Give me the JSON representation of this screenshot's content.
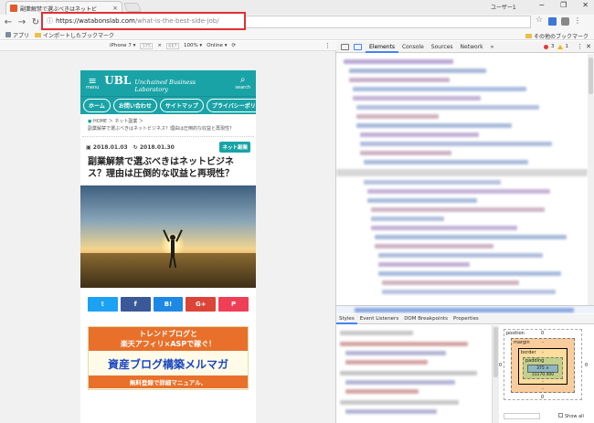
{
  "window": {
    "tab_title": "副業解禁で選ぶべきはネットビ",
    "user_label": "ユーザー1"
  },
  "toolbar": {
    "url_host": "https://watabonslab.com",
    "url_path": "/what-is-the-best-side-job/"
  },
  "bookmarks": {
    "apps_label": "アプリ",
    "imported_label": "インポートしたブックマーク",
    "other_label": "その他のブックマーク"
  },
  "device_bar": {
    "device": "iPhone 7",
    "width": "375",
    "height": "667",
    "zoom": "100%",
    "network": "Online"
  },
  "site": {
    "logo_main": "UBL",
    "logo_sub": "Unchained Business Laboratory",
    "menu_label": "menu",
    "search_label": "search",
    "nav": [
      "ホーム",
      "お問い合わせ",
      "サイトマップ",
      "プライバシーポリ"
    ],
    "crumb_home": "HOME",
    "crumb_category": "ネット副業",
    "crumb_current": "副業解禁で選ぶべきはネットビジネス？理由は圧倒的な収益と再現性？",
    "date_published": "2018.01.03",
    "date_updated": "2018.01.30",
    "category_badge": "ネット副業",
    "article_title": "副業解禁で選ぶべきはネットビジネス？理由は圧倒的な収益と再現性？",
    "share": [
      {
        "label": "𝕥",
        "color": "#1da1f2"
      },
      {
        "label": "f",
        "color": "#3b5998"
      },
      {
        "label": "B!",
        "color": "#1e88e5"
      },
      {
        "label": "G+",
        "color": "#db4437"
      },
      {
        "label": "P",
        "color": "#ef3f56"
      }
    ],
    "banner_line1": "トレンドブログと",
    "banner_line2": "楽天アフィリ×ASPで稼ぐ！",
    "banner_title": "資産ブログ構築メルマガ",
    "banner_bottom": "無料登録で詳細マニュアル、"
  },
  "devtools": {
    "tabs": [
      "Elements",
      "Console",
      "Sources",
      "Network",
      "»"
    ],
    "error_count": "3",
    "warning_count": "1",
    "sub_tabs": [
      "Styles",
      "Event Listeners",
      "DOM Breakpoints",
      "Properties"
    ],
    "box_position": "position",
    "box_margin": "margin",
    "box_border": "border",
    "box_padding": "padding",
    "box_content": "375 × 31170.400",
    "zero": "0",
    "dash": "-",
    "show_all": "Show all"
  }
}
